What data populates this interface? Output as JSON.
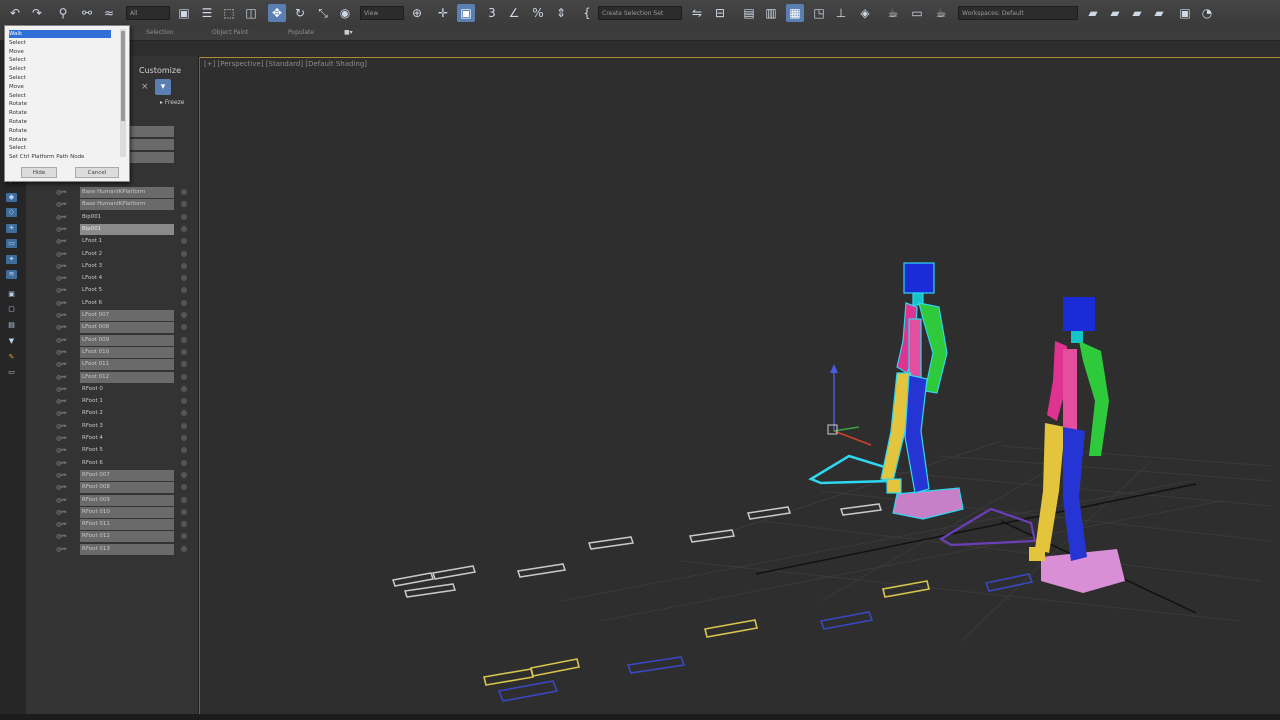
{
  "toolbar": {
    "selection_filter": "All",
    "view_dropdown": "View",
    "named_selection": "Create Selection Set",
    "workspace": "Workspaces: Default"
  },
  "ribbon": {
    "tabs": [
      "Selection",
      "Object Paint",
      "Populate"
    ]
  },
  "scene_panel": {
    "customize_label": "Customize",
    "freeze_label": "Freeze",
    "rows": [
      {
        "label": "Base HumanIKPlatform",
        "state": "hl"
      },
      {
        "label": "Base HumanIKPlatform",
        "state": "hl"
      },
      {
        "label": "Bip001",
        "state": ""
      },
      {
        "label": "Bip001",
        "state": "sel"
      },
      {
        "label": "LFoot 1",
        "state": ""
      },
      {
        "label": "LFoot 2",
        "state": ""
      },
      {
        "label": "LFoot 3",
        "state": ""
      },
      {
        "label": "LFoot 4",
        "state": ""
      },
      {
        "label": "LFoot 5",
        "state": ""
      },
      {
        "label": "LFoot 6",
        "state": ""
      },
      {
        "label": "LFoot 007",
        "state": "hl"
      },
      {
        "label": "LFoot 008",
        "state": "hl"
      },
      {
        "label": "LFoot 009",
        "state": "hl"
      },
      {
        "label": "LFoot 010",
        "state": "hl"
      },
      {
        "label": "LFoot 011",
        "state": "hl"
      },
      {
        "label": "LFoot 012",
        "state": "hl"
      },
      {
        "label": "RFoot 0",
        "state": ""
      },
      {
        "label": "RFoot 1",
        "state": ""
      },
      {
        "label": "RFoot 2",
        "state": ""
      },
      {
        "label": "RFoot 3",
        "state": ""
      },
      {
        "label": "RFoot 4",
        "state": ""
      },
      {
        "label": "RFoot 5",
        "state": ""
      },
      {
        "label": "RFoot 6",
        "state": ""
      },
      {
        "label": "RFoot 007",
        "state": "hl"
      },
      {
        "label": "RFoot 008",
        "state": "hl"
      },
      {
        "label": "RFoot 009",
        "state": "hl"
      },
      {
        "label": "RFoot 010",
        "state": "hl"
      },
      {
        "label": "RFoot 011",
        "state": "hl"
      },
      {
        "label": "RFoot 012",
        "state": "hl"
      },
      {
        "label": "RFoot 013",
        "state": "hl"
      }
    ]
  },
  "dropdown": {
    "items": [
      "Walk",
      "Select",
      "Move",
      "Select",
      "Select",
      "Select",
      "Move",
      "Select",
      "Rotate",
      "Rotate",
      "Rotate",
      "Rotate",
      "Rotate",
      "Select",
      "Set Ctrl Platform Path Node"
    ],
    "ok_label": "Hide",
    "cancel_label": "Cancel"
  },
  "viewport": {
    "label": "[+] [Perspective] [Standard] [Default Shading]"
  },
  "colors": {
    "accent_blue": "#5b7fb3",
    "viewport_border": "#b08a3a",
    "left_foot": "#e8d25a",
    "right_foot": "#3a48c8"
  }
}
